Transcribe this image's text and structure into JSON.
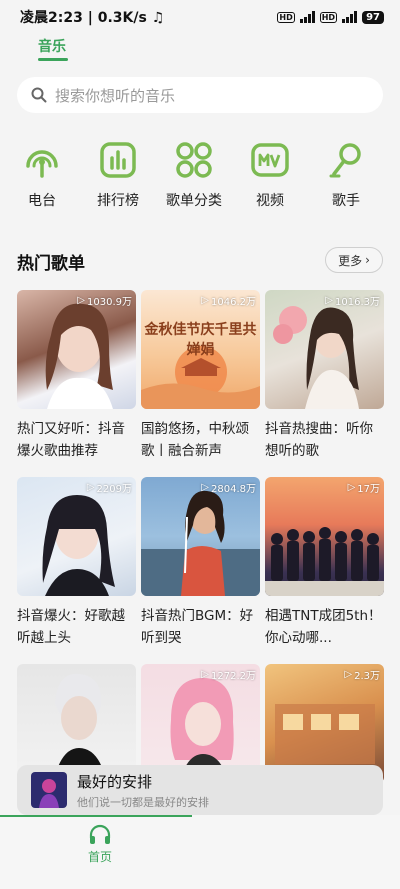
{
  "status": {
    "time": "凌晨2:23",
    "speed": "0.3K/s",
    "hd1": "HD",
    "hd2": "HD",
    "battery": "97"
  },
  "top_tab": {
    "label": "音乐"
  },
  "search": {
    "placeholder": "搜索你想听的音乐"
  },
  "categories": [
    {
      "label": "电台",
      "icon": "radio-icon"
    },
    {
      "label": "排行榜",
      "icon": "chart-icon"
    },
    {
      "label": "歌单分类",
      "icon": "grid-icon"
    },
    {
      "label": "视频",
      "icon": "mv-icon"
    },
    {
      "label": "歌手",
      "icon": "singer-icon"
    }
  ],
  "section": {
    "title": "热门歌单",
    "more": "更多"
  },
  "playlists": [
    {
      "count": "1030.9万",
      "title": "热门又好听：抖音爆火歌曲推荐",
      "thumb_text": ""
    },
    {
      "count": "1046.2万",
      "title": "国韵悠扬，中秋颂歌丨融合新声",
      "thumb_text": "金秋佳节庆千里共婵娟"
    },
    {
      "count": "1016.3万",
      "title": "抖音热搜曲：听你想听的歌",
      "thumb_text": ""
    },
    {
      "count": "2209万",
      "title": "抖音爆火：好歌越听越上头",
      "thumb_text": ""
    },
    {
      "count": "2804.8万",
      "title": "抖音热门BGM：好听到哭",
      "thumb_text": ""
    },
    {
      "count": "17万",
      "title": "相遇TNT成团5th！你心动哪...",
      "thumb_text": ""
    },
    {
      "count": "",
      "title": "",
      "thumb_text": ""
    },
    {
      "count": "1272.2万",
      "title": "",
      "thumb_text": ""
    },
    {
      "count": "2.3万",
      "title": "",
      "thumb_text": ""
    }
  ],
  "mini_player": {
    "title": "最好的安排",
    "subtitle": "他们说一切都是最好的安排"
  },
  "tabbar": {
    "home": "首页"
  },
  "colors": {
    "accent": "#3ba45b",
    "icon_green": "#7cba52"
  }
}
